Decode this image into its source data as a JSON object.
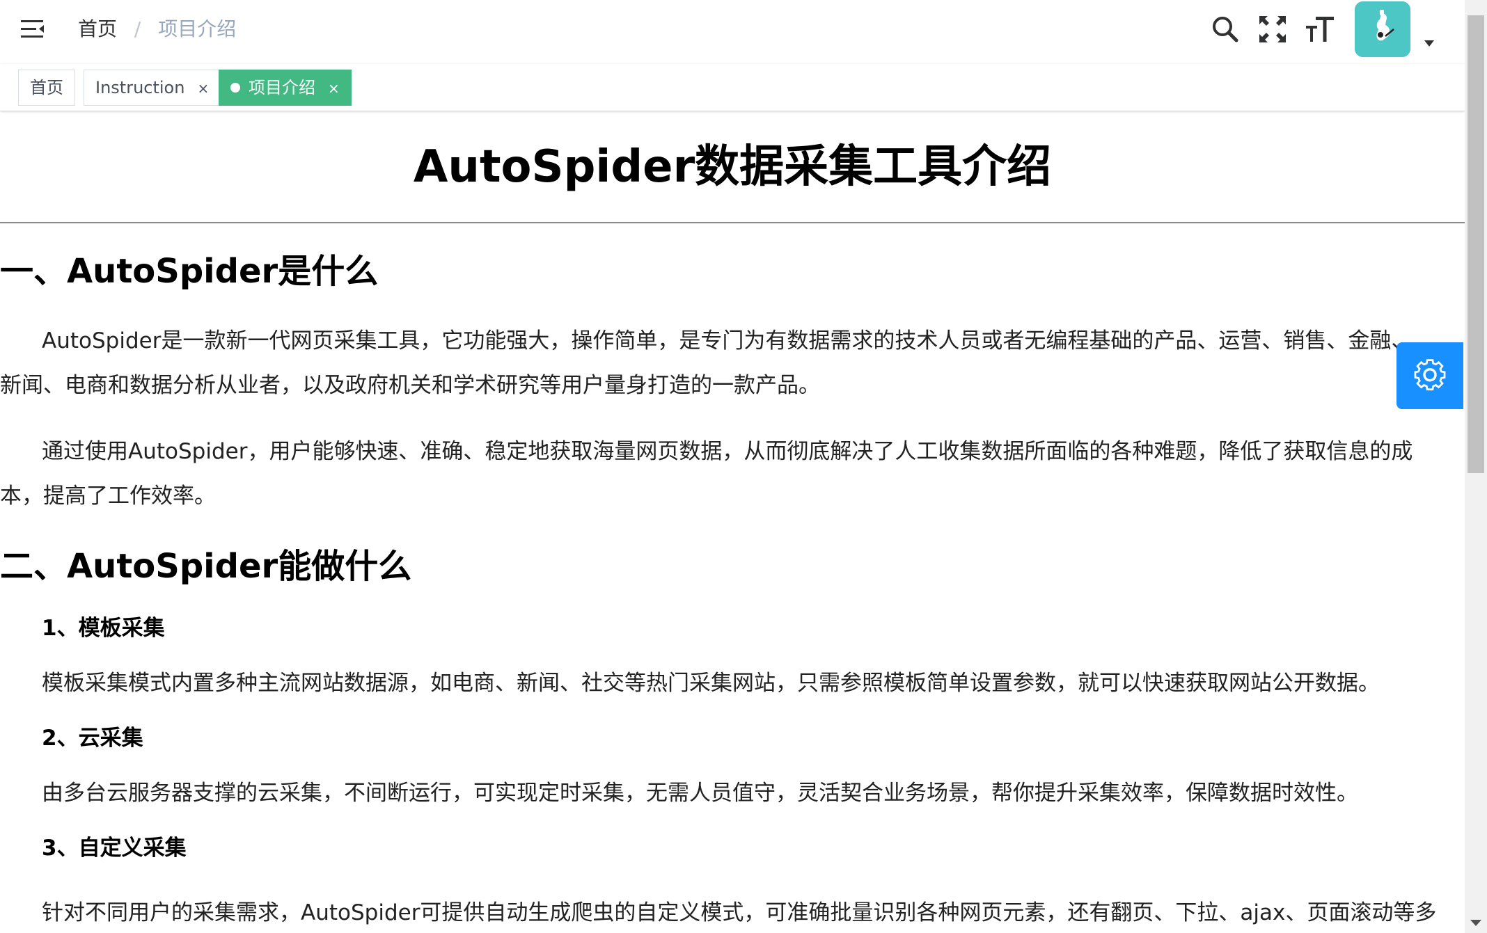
{
  "navbar": {
    "hamburger_icon": "hamburger-menu-icon",
    "breadcrumb": {
      "home": "首页",
      "separator": "/",
      "current": "项目介绍"
    },
    "icons": [
      "search-icon",
      "fullscreen-icon",
      "font-size-icon"
    ],
    "avatar_icon": "user-avatar",
    "dropdown_icon": "caret-down-icon"
  },
  "tags_view": {
    "tags": [
      {
        "label": "首页",
        "closable": false,
        "active": false
      },
      {
        "label": "Instruction",
        "closable": true,
        "active": false
      },
      {
        "label": "项目介绍",
        "closable": true,
        "active": true
      }
    ],
    "close_glyph": "×",
    "active_color": "#42b983"
  },
  "document": {
    "title": "AutoSpider数据采集工具介绍",
    "section1": {
      "heading": "一、AutoSpider是什么",
      "p1_line1": "AutoSpider是一款新一代网页采集工具，它功能强大，操作简单，是专门为有数据需求的技术人员或者无编程基础的产品、运营、销售、金融、",
      "p1_line2": "新闻、电商和数据分析从业者，以及政府机关和学术研究等用户量身打造的一款产品。",
      "p2_line1": "通过使用AutoSpider，用户能够快速、准确、稳定地获取海量网页数据，从而彻底解决了人工收集数据所面临的各种难题，降低了获取信息的成",
      "p2_line2": "本，提高了工作效率。"
    },
    "section2": {
      "heading": "二、AutoSpider能做什么",
      "items": [
        {
          "title": "1、模板采集",
          "text": "模板采集模式内置多种主流网站数据源，如电商、新闻、社交等热门采集网站，只需参照模板简单设置参数，就可以快速获取网站公开数据。"
        },
        {
          "title": "2、云采集",
          "text": "由多台云服务器支撑的云采集，不间断运行，可实现定时采集，无需人员值守，灵活契合业务场景，帮你提升采集效率，保障数据时效性。"
        },
        {
          "title": "3、自定义采集",
          "text": "针对不同用户的采集需求，AutoSpider可提供自动生成爬虫的自定义模式，可准确批量识别各种网页元素，还有翻页、下拉、ajax、页面滚动等多"
        }
      ]
    }
  },
  "settings_button": {
    "icon": "gear-icon",
    "color": "#1890ff"
  }
}
